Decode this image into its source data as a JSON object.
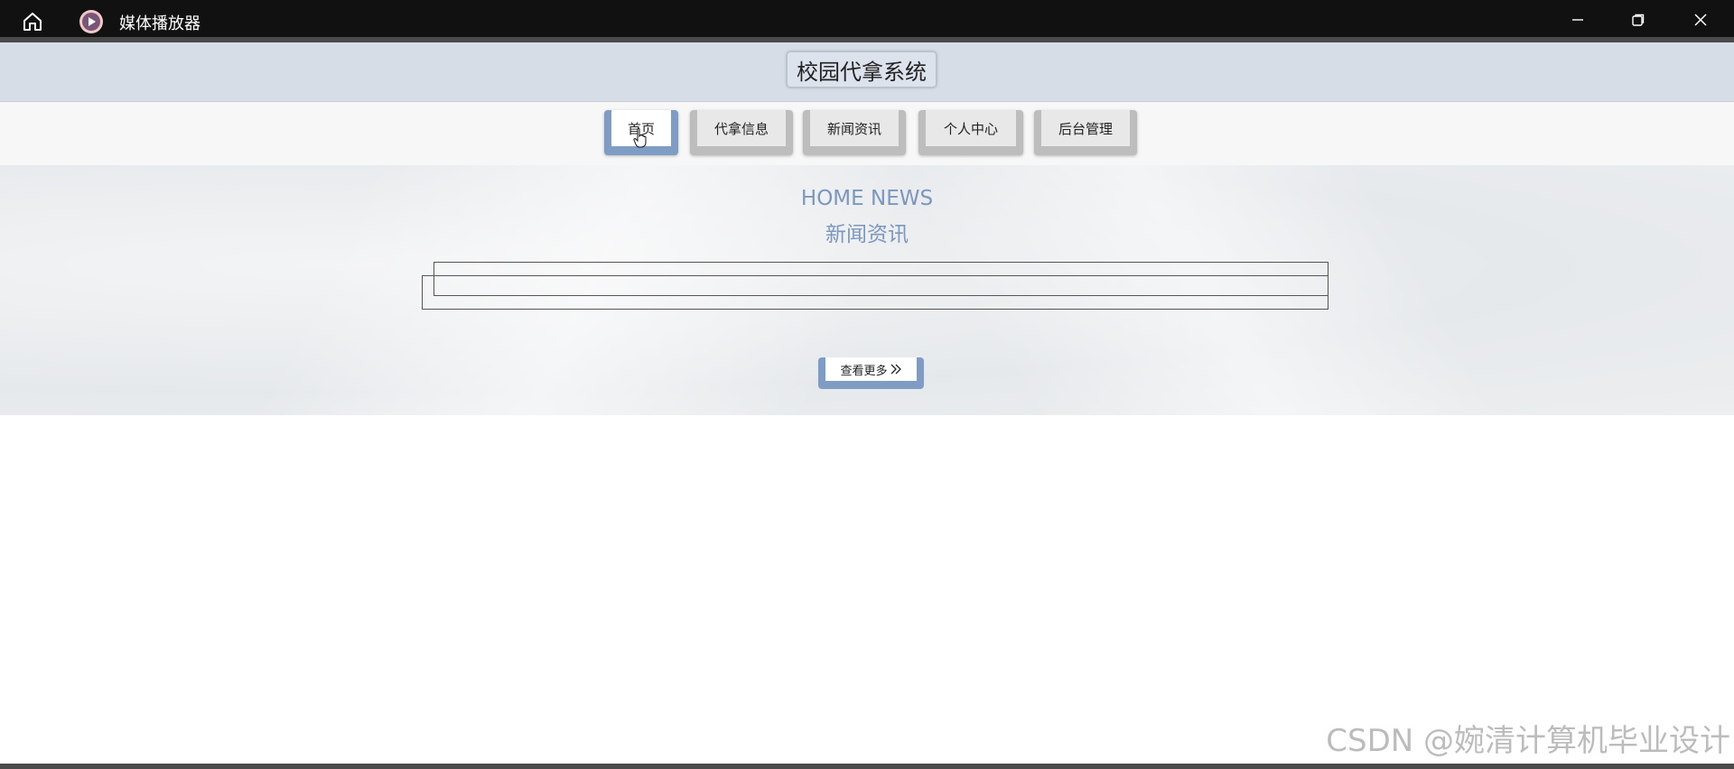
{
  "window": {
    "app_title": "媒体播放器",
    "icons": {
      "home": "home-icon",
      "app": "media-player-icon",
      "minimize": "minimize-icon",
      "maximize": "restore-icon",
      "close": "close-icon"
    }
  },
  "site": {
    "title": "校园代拿系统"
  },
  "nav": {
    "items": [
      {
        "label": "首页",
        "active": true
      },
      {
        "label": "代拿信息",
        "active": false
      },
      {
        "label": "新闻资讯",
        "active": false
      },
      {
        "label": "个人中心",
        "active": false
      },
      {
        "label": "后台管理",
        "active": false
      }
    ]
  },
  "news": {
    "heading_en": "HOME NEWS",
    "heading_cn": "新闻资讯",
    "more_label": "查看更多"
  },
  "watermark": "CSDN @婉清计算机毕业设计",
  "colors": {
    "accent": "#7f9dc4",
    "titlebar": "#111111",
    "header": "#d6dde7"
  }
}
